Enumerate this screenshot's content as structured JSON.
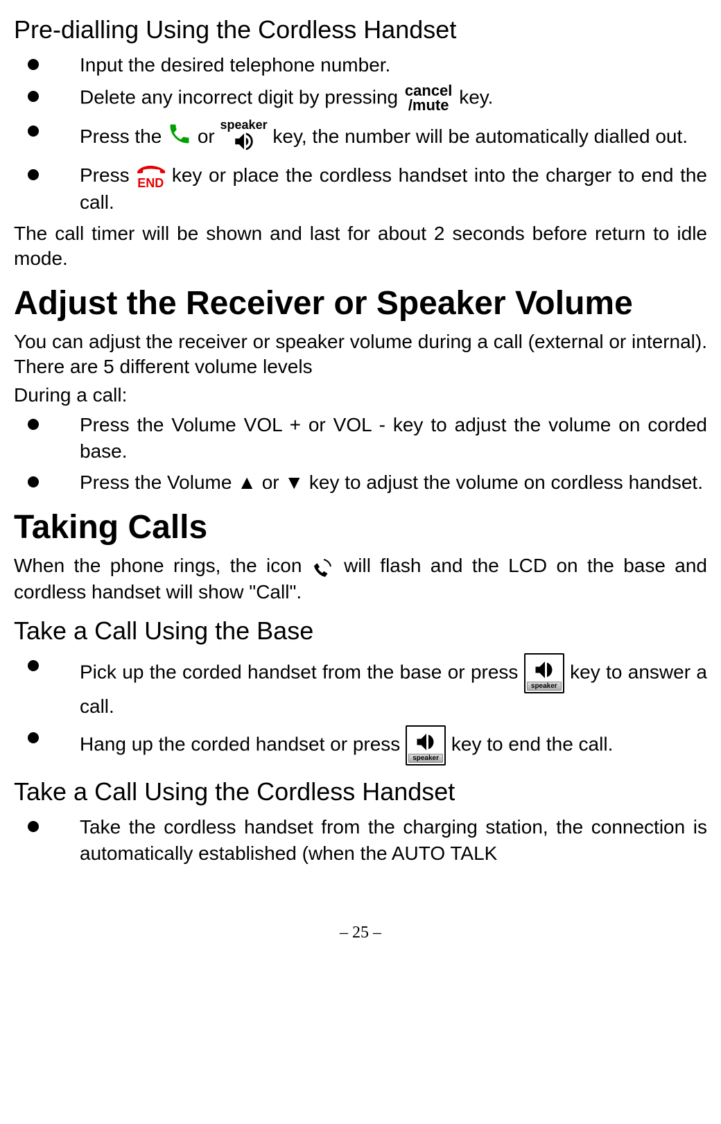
{
  "headings": {
    "preDialling": "Pre-dialling Using the Cordless Handset",
    "adjustVolume": "Adjust the Receiver or Speaker Volume",
    "takingCalls": "Taking Calls",
    "takeBase": "Take a Call Using the Base",
    "takeCordless": "Take a Call Using the Cordless Handset"
  },
  "preDialling": {
    "b1": "Input the desired telephone number.",
    "b2_a": "Delete any incorrect digit by pressing ",
    "b2_b": " key.",
    "b3_a": "Press the ",
    "b3_b": " or ",
    "b3_c": " key, the number will be automatically dialled out.",
    "b4_a": "Press ",
    "b4_b": " key or place the cordless handset into the charger to end the call.",
    "after": "The call timer will be shown and last for about 2 seconds before return to idle mode."
  },
  "adjustVolume": {
    "p1": "You can adjust the receiver or speaker volume during a call (external or internal). There are 5 different volume levels",
    "p2": "During a call:",
    "b1": "Press the Volume VOL + or VOL - key to adjust the volume on corded base.",
    "b2": "Press the Volume ▲ or ▼ key to adjust the volume on cordless handset."
  },
  "takingCalls": {
    "p_a": "When the phone rings, the icon ",
    "p_b": " will flash and the LCD on the base and cordless handset will show \"Call\"."
  },
  "takeBase": {
    "b1_a": "Pick up the corded handset from the base or press ",
    "b1_b": " key to answer a call.",
    "b2_a": "Hang up the corded handset or press ",
    "b2_b": " key to end the call."
  },
  "takeCordless": {
    "b1": "Take the cordless handset from the charging station, the connection is automatically established (when the AUTO TALK"
  },
  "labels": {
    "cancel": "cancel",
    "mute": "/mute",
    "speaker": "speaker",
    "end": "END"
  },
  "pageNumber": "– 25 –"
}
